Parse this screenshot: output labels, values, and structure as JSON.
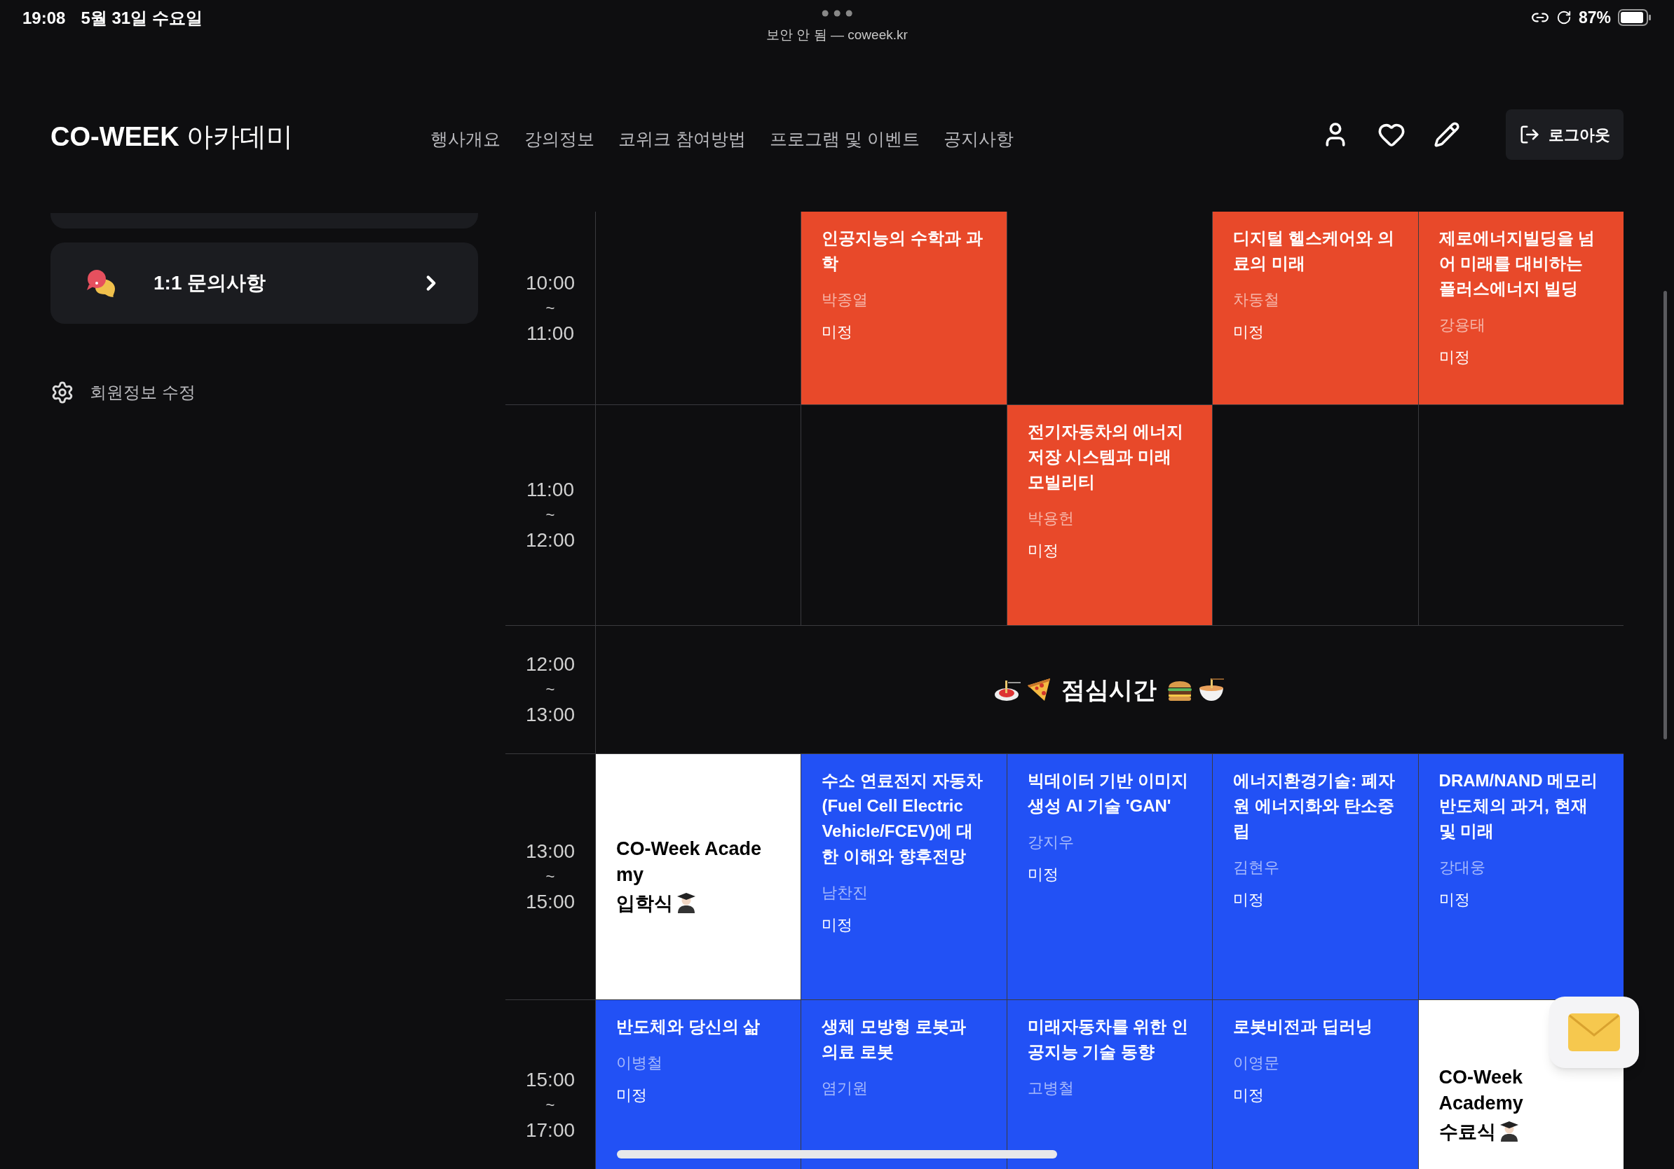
{
  "status_bar": {
    "time": "19:08",
    "date": "5월 31일 수요일",
    "url": "보안 안 됨 — coweek.kr",
    "battery": "87%"
  },
  "header": {
    "logo_bold": "CO-WEEK",
    "logo_rest": "아카데미",
    "nav": [
      "행사개요",
      "강의정보",
      "코위크 참여방법",
      "프로그램 및 이벤트",
      "공지사항"
    ],
    "logout": "로그아웃"
  },
  "sidebar": {
    "inquiry": "1:1 문의사항",
    "settings": "회원정보 수정"
  },
  "timetable": {
    "rows": [
      {
        "kind": "slots",
        "start": "10:00",
        "separator": "~",
        "end": "11:00",
        "cells": [
          {
            "kind": "empty"
          },
          {
            "kind": "lecture",
            "color": "#e8492a",
            "title": "인공지능의 수학과 과학",
            "speaker": "박종열",
            "location": "미정"
          },
          {
            "kind": "empty"
          },
          {
            "kind": "lecture",
            "color": "#e8492a",
            "title": "디지털 헬스케어와 의료의 미래",
            "speaker": "차동철",
            "location": "미정"
          },
          {
            "kind": "lecture",
            "color": "#e8492a",
            "title": "제로에너지빌딩을 넘어 미래를 대비하는 플러스에너지 빌딩",
            "speaker": "강용태",
            "location": "미정"
          }
        ]
      },
      {
        "kind": "slots",
        "start": "11:00",
        "separator": "~",
        "end": "12:00",
        "cells": [
          {
            "kind": "empty"
          },
          {
            "kind": "empty"
          },
          {
            "kind": "lecture",
            "color": "#e8492a",
            "title": "전기자동차의 에너지 저장 시스템과 미래 모빌리티",
            "speaker": "박용헌",
            "location": "미정"
          },
          {
            "kind": "empty"
          },
          {
            "kind": "empty"
          }
        ]
      },
      {
        "kind": "break",
        "start": "12:00",
        "separator": "~",
        "end": "13:00",
        "label": "점심시간"
      },
      {
        "kind": "slots",
        "start": "13:00",
        "separator": "~",
        "end": "15:00",
        "cells": [
          {
            "kind": "ceremony",
            "title": "CO-Week Acade my",
            "subtitle": "입학식"
          },
          {
            "kind": "lecture",
            "color": "#2251f5",
            "title": "수소 연료전지 자동차(Fuel Cell Electric Vehicle/FCEV)에 대한 이해와 향후전망",
            "speaker": "남찬진",
            "location": "미정"
          },
          {
            "kind": "lecture",
            "color": "#2251f5",
            "title": "빅데이터 기반 이미지 생성 AI 기술 'GAN'",
            "speaker": "강지우",
            "location": "미정"
          },
          {
            "kind": "lecture",
            "color": "#2251f5",
            "title": "에너지환경기술: 폐자원 에너지화와 탄소중립",
            "speaker": "김현우",
            "location": "미정"
          },
          {
            "kind": "lecture",
            "color": "#2251f5",
            "title": "DRAM/NAND 메모리 반도체의 과거, 현재 및 미래",
            "speaker": "강대웅",
            "location": "미정"
          }
        ]
      },
      {
        "kind": "slots",
        "start": "15:00",
        "separator": "~",
        "end": "17:00",
        "cells": [
          {
            "kind": "lecture",
            "color": "#2251f5",
            "title": "반도체와 당신의 삶",
            "speaker": "이병철",
            "location": "미정"
          },
          {
            "kind": "lecture",
            "color": "#2251f5",
            "title": "생체 모방형 로봇과 의료 로봇",
            "speaker": "염기원"
          },
          {
            "kind": "lecture",
            "color": "#2251f5",
            "title": "미래자동차를 위한 인공지능 기술 동향",
            "speaker": "고병철"
          },
          {
            "kind": "lecture",
            "color": "#2251f5",
            "title": "로봇비전과 딥러닝",
            "speaker": "이영문",
            "location": "미정"
          },
          {
            "kind": "ceremony",
            "title": "CO-Week Academy",
            "subtitle": "수료식"
          }
        ]
      }
    ]
  }
}
